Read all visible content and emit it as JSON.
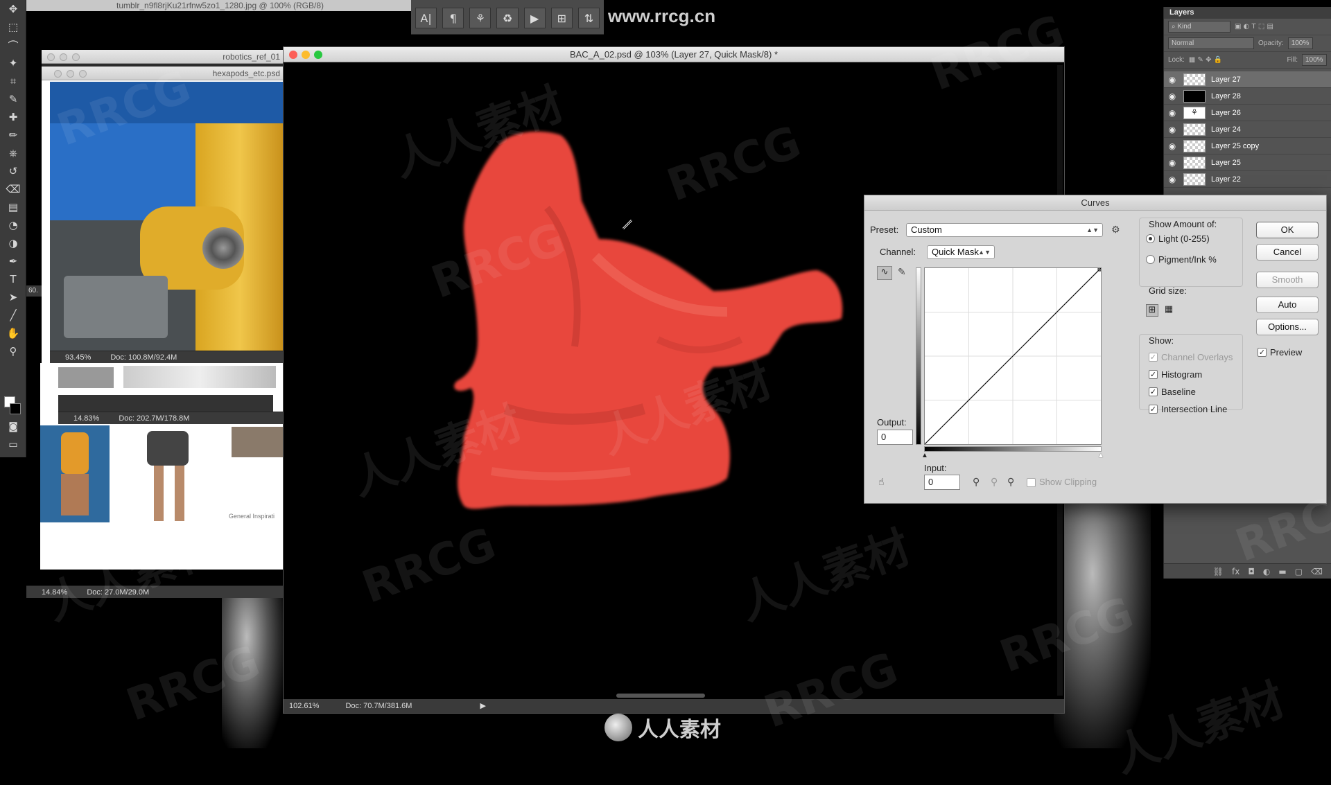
{
  "background": {
    "site_watermark": "www.rrcg.cn",
    "bottom_logo": "人人素材",
    "watermark_a": "RRCG",
    "watermark_b": "人人素材"
  },
  "toolbar": {
    "tools": [
      "move-tool",
      "marquee-tool",
      "lasso-tool",
      "magic-wand-tool",
      "crop-tool",
      "eyedropper-tool",
      "healing-brush-tool",
      "brush-tool",
      "clone-stamp-tool",
      "history-brush-tool",
      "eraser-tool",
      "gradient-tool",
      "blur-tool",
      "dodge-tool",
      "pen-tool",
      "type-tool",
      "path-selection-tool",
      "line-tool",
      "hand-tool",
      "zoom-tool"
    ],
    "side_readout": "60."
  },
  "top_doc": {
    "title": "tumblr_n9fl8rjKu21rfnw5zo1_1280.jpg @ 100% (RGB/8)"
  },
  "option_bar": {
    "buttons": [
      "A|",
      "¶",
      "⚘",
      "♻",
      "▶",
      "⊞",
      "⇅"
    ]
  },
  "ref_windows": [
    {
      "title": "robotics_ref_01",
      "zoom": "93.45%",
      "doc": "Doc: 100.8M/92.4M"
    },
    {
      "title": "hexapods_etc.psd",
      "zoom": "14.83%",
      "doc": "Doc: 202.7M/178.8M",
      "caption": "General Inspirati"
    },
    {
      "zoom": "14.84%",
      "doc": "Doc: 27.0M/29.0M"
    }
  ],
  "main_doc": {
    "title": "BAC_A_02.psd @ 103% (Layer 27, Quick Mask/8) *",
    "zoom": "102.61%",
    "doc": "Doc: 70.7M/381.6M"
  },
  "layers_panel": {
    "tab": "Layers",
    "kind": "⌕ Kind",
    "blend_mode": "Normal",
    "opacity_label": "Opacity:",
    "opacity": "100%",
    "lock_label": "Lock:",
    "fill_label": "Fill:",
    "fill": "100%",
    "layers": [
      {
        "name": "Layer 27",
        "selected": true,
        "thumb": "transparent"
      },
      {
        "name": "Layer 28",
        "selected": false,
        "thumb": "black"
      },
      {
        "name": "Layer 26",
        "selected": false,
        "thumb": "figure"
      },
      {
        "name": "Layer 24",
        "selected": false,
        "thumb": "transparent"
      },
      {
        "name": "Layer 25 copy",
        "selected": false,
        "thumb": "transparent"
      },
      {
        "name": "Layer 25",
        "selected": false,
        "thumb": "transparent"
      },
      {
        "name": "Layer 22",
        "selected": false,
        "thumb": "transparent"
      }
    ]
  },
  "curves": {
    "title": "Curves",
    "preset_label": "Preset:",
    "preset_value": "Custom",
    "channel_label": "Channel:",
    "channel_value": "Quick Mask",
    "output_label": "Output:",
    "output_value": "0",
    "input_label": "Input:",
    "input_value": "0",
    "show_clipping": "Show Clipping",
    "show_amount_label": "Show Amount of:",
    "light_label": "Light  (0-255)",
    "pigment_label": "Pigment/Ink %",
    "grid_size_label": "Grid size:",
    "show_label": "Show:",
    "channel_overlays": "Channel Overlays",
    "histogram": "Histogram",
    "baseline": "Baseline",
    "intersection_line": "Intersection Line",
    "buttons": {
      "ok": "OK",
      "cancel": "Cancel",
      "smooth": "Smooth",
      "auto": "Auto",
      "options": "Options..."
    },
    "preview_label": "Preview"
  },
  "colors": {
    "mask_red": "#e8463c",
    "panel_gray": "#535353",
    "dialog_gray": "#d6d6d6"
  }
}
